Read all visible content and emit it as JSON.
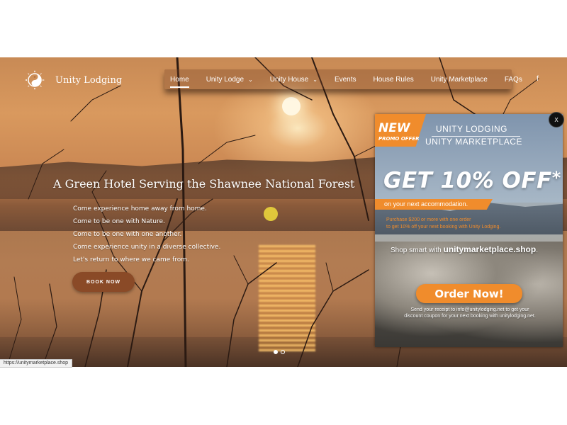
{
  "brand": {
    "name": "Unity Lodging",
    "logo_icon": "yin-yang-sun-icon"
  },
  "nav": {
    "items": [
      {
        "label": "Home",
        "active": true,
        "has_dropdown": false
      },
      {
        "label": "Unity Lodge",
        "active": false,
        "has_dropdown": true
      },
      {
        "label": "Unity House",
        "active": false,
        "has_dropdown": true
      },
      {
        "label": "Events",
        "active": false,
        "has_dropdown": false
      },
      {
        "label": "House Rules",
        "active": false,
        "has_dropdown": false
      },
      {
        "label": "Unity Marketplace",
        "active": false,
        "has_dropdown": false
      },
      {
        "label": "FAQs",
        "active": false,
        "has_dropdown": false
      }
    ],
    "chevron": "⌄",
    "social": "f"
  },
  "hero": {
    "title": "A Green Hotel Serving the Shawnee National Forest",
    "lines": [
      "Come experience home away from home.",
      "Come to be one with Nature.",
      "Come to be one with one another.",
      "Come experience unity in a diverse collective.",
      "Let's return to where we came from."
    ],
    "button": "BOOK NOW",
    "slides": 2,
    "active_slide": 0
  },
  "promo": {
    "new_label": "NEW",
    "new_sub": "PROMO OFFER",
    "brand_line1": "UNITY LODGING",
    "brand_line2": "UNITY MARKETPLACE",
    "headline": "GET 10% OFF",
    "headline_star": "*",
    "accommodation": "on your next accommodation.",
    "purchase_line1": "Purchase $200 or more with one order",
    "purchase_line2": "to get 10% off your next booking with Unity Lodging.",
    "shop_prefix": "Shop smart with ",
    "shop_site": "unitymarketplace.shop",
    "shop_suffix": ".",
    "order_button": "Order Now!",
    "send_line1": "Send your receipt to info@unitylodging.net to get your",
    "send_line2": "discount coupon for your next booking with unitylodging.net.",
    "close_label": "X",
    "accent": "#f08c2c"
  },
  "status_url": "https://unitymarketplace.shop"
}
